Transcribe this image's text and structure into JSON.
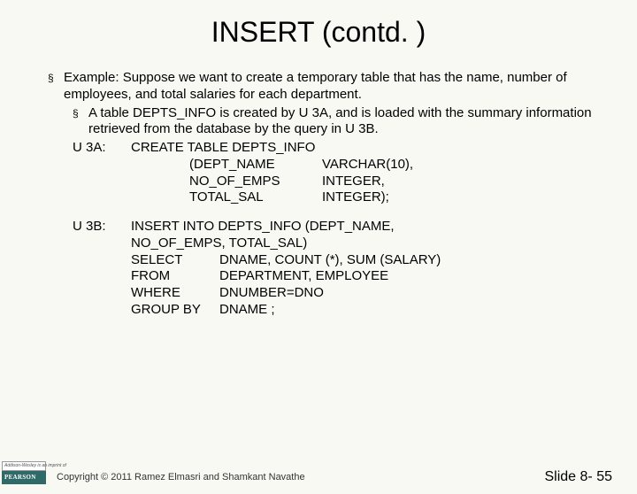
{
  "title": "INSERT (contd. )",
  "example_intro": "Example: Suppose we want to create a temporary table that has the name, number of employees, and total salaries for each department.",
  "sub_point": "A table DEPTS_INFO is created by U 3A, and is loaded with the summary information retrieved from the database by the query in U 3B.",
  "u3a": {
    "label": "U 3A:",
    "line1": "CREATE TABLE  DEPTS_INFO",
    "cols": [
      {
        "name": "(DEPT_NAME",
        "type": "VARCHAR(10),"
      },
      {
        "name": " NO_OF_EMPS",
        "type": "INTEGER,"
      },
      {
        "name": " TOTAL_SAL",
        "type": "INTEGER);"
      }
    ]
  },
  "u3b": {
    "label": "U 3B:",
    "line1": "INSERT INTO   DEPTS_INFO (DEPT_NAME,",
    "line2": "NO_OF_EMPS, TOTAL_SAL)",
    "rows": [
      {
        "kw": "SELECT",
        "val": "DNAME, COUNT (*), SUM (SALARY)"
      },
      {
        "kw": "FROM",
        "val": "DEPARTMENT, EMPLOYEE"
      },
      {
        "kw": "WHERE",
        "val": "DNUMBER=DNO"
      },
      {
        "kw": "GROUP BY",
        "val": "DNAME ;"
      }
    ]
  },
  "logo_top": "Addison-Wesley is an imprint of",
  "logo_bot": "PEARSON",
  "copyright": "Copyright © 2011 Ramez Elmasri and Shamkant Navathe",
  "slide_number": "Slide 8- 55"
}
